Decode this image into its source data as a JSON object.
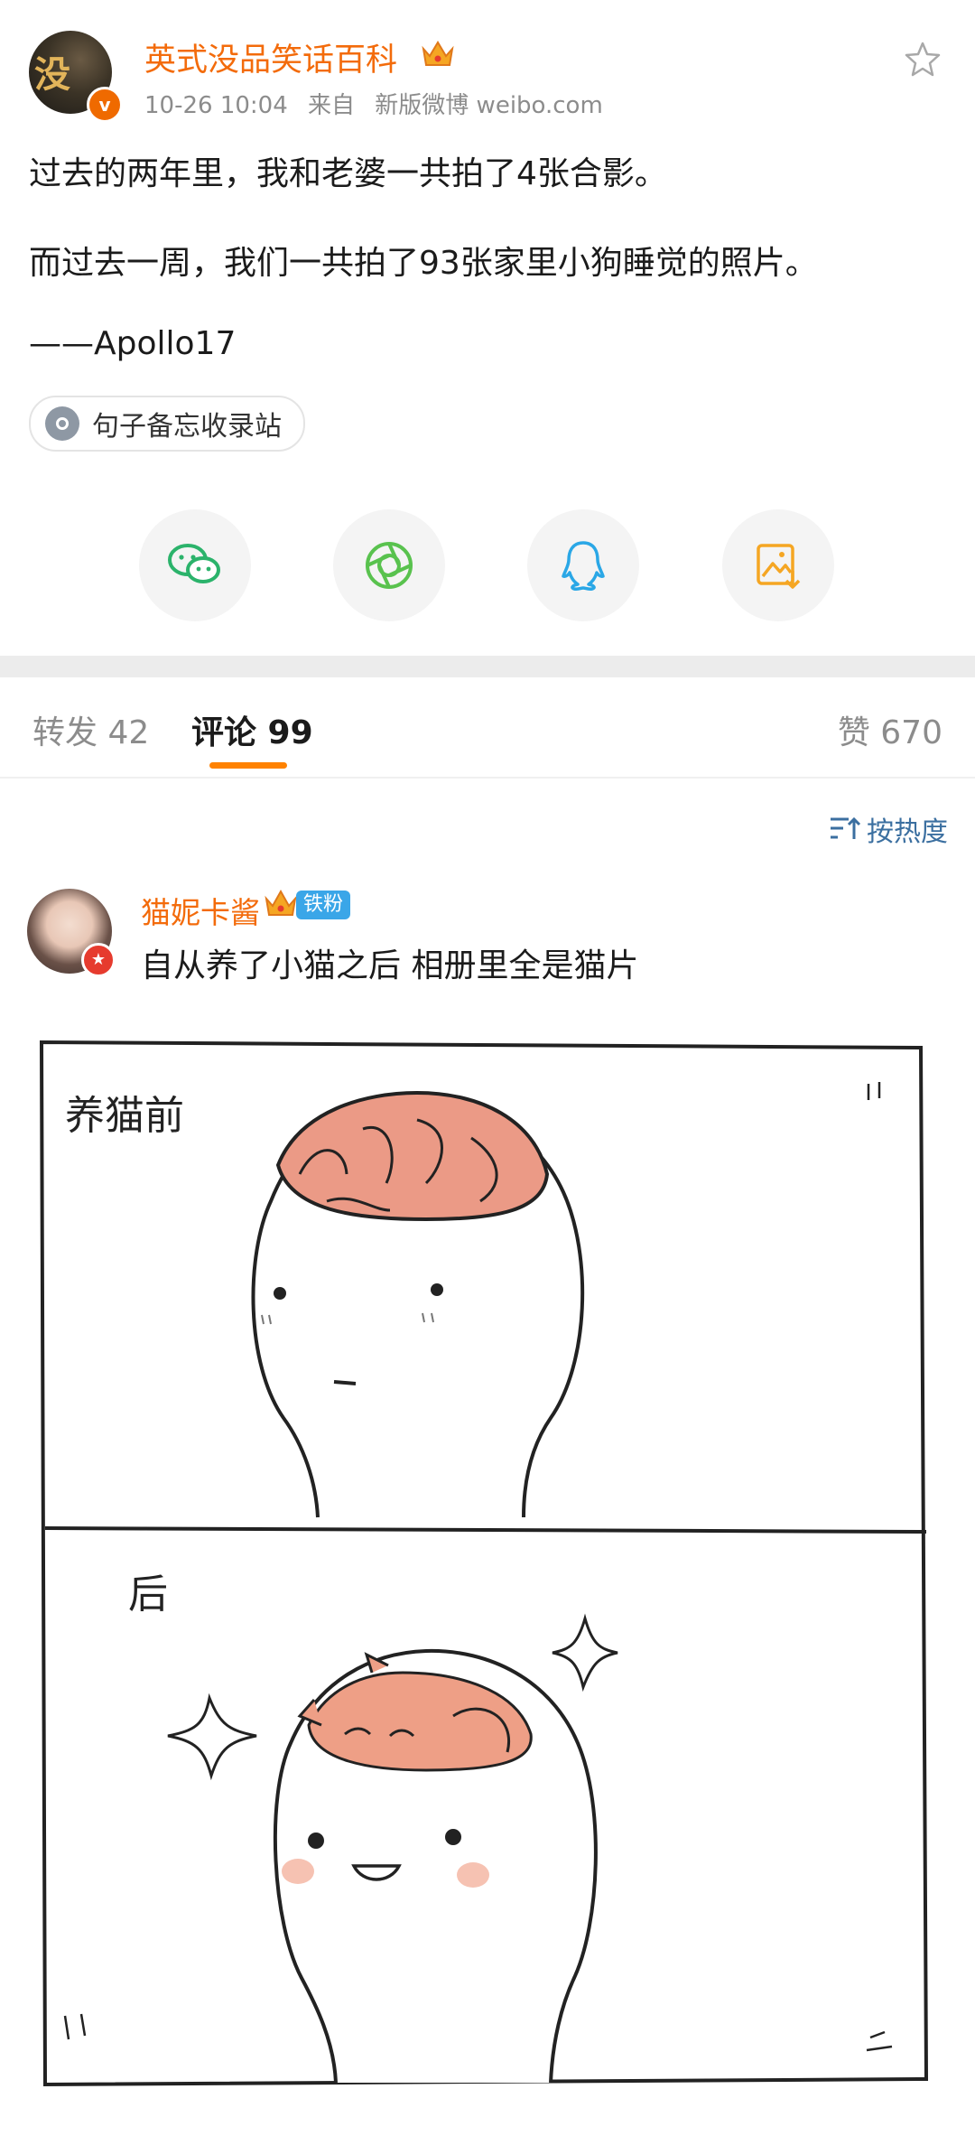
{
  "post": {
    "author": {
      "name": "英式没品笑话百科",
      "avatar_glyph": "没",
      "verified_badge": "v"
    },
    "meta": {
      "time": "10-26 10:04",
      "source_prefix": "来自",
      "source": "新版微博 weibo.com"
    },
    "text_lines": [
      "过去的两年里，我和老婆一共拍了4张合影。",
      "而过去一周，我们一共拍了93张家里小狗睡觉的照片。",
      "——Apollo17"
    ],
    "tag": "句子备忘收录站"
  },
  "share": {
    "items": [
      "wechat-icon",
      "moments-icon",
      "qq-icon",
      "save-image-icon"
    ],
    "colors": {
      "wechat": "#2bb36b",
      "moments": "#59c24e",
      "qq": "#2aa7e6",
      "save": "#f5a623"
    }
  },
  "tabs": {
    "repost": "转发 42",
    "comments": "评论 99",
    "likes": "赞 670"
  },
  "sort": {
    "label": "按热度"
  },
  "comment": {
    "author": "猫妮卡酱",
    "fan_badge": "铁粉",
    "text": "自从养了小猫之后 相册里全是猫片"
  },
  "comment_image": {
    "panel_top_caption": "养猫前",
    "panel_bottom_caption": "后"
  },
  "theme": {
    "accent": "#ff8200",
    "name_color": "#f36b0b",
    "link_color": "#3b6fa0"
  }
}
